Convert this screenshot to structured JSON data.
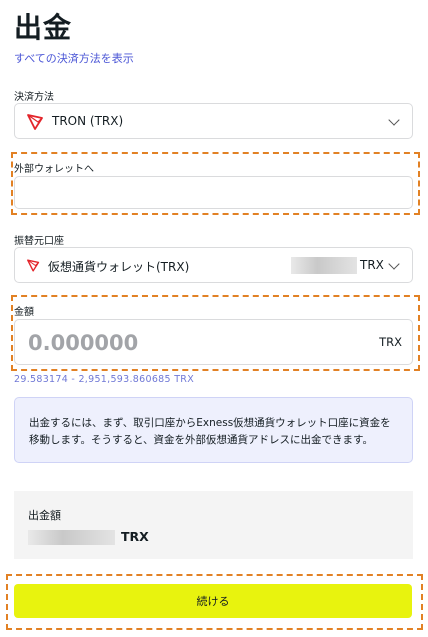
{
  "page": {
    "title": "出金",
    "show_all_methods_link": "すべての決済方法を表示"
  },
  "payment_method": {
    "label": "決済方法",
    "value": "TRON (TRX)",
    "icon": "tron-logo-icon",
    "accent": "#e3252b"
  },
  "external_wallet": {
    "label": "外部ウォレットへ",
    "value": ""
  },
  "source_account": {
    "label": "振替元口座",
    "value": "仮想通貨ウォレット(TRX)",
    "currency": "TRX",
    "icon": "tron-logo-icon"
  },
  "amount": {
    "label": "金額",
    "placeholder": "0.000000",
    "currency": "TRX",
    "range": "29.583174 - 2,951,593.860685 TRX"
  },
  "info": {
    "text": "出金するには、まず、取引口座からExness仮想通貨ウォレット口座に資金を移動します。そうすると、資金を外部仮想通貨アドレスに出金できます。"
  },
  "summary": {
    "label": "出金額",
    "currency": "TRX"
  },
  "continue_button": {
    "label": "続ける",
    "color": "#e8f30e"
  },
  "highlight_color": "#e28124"
}
